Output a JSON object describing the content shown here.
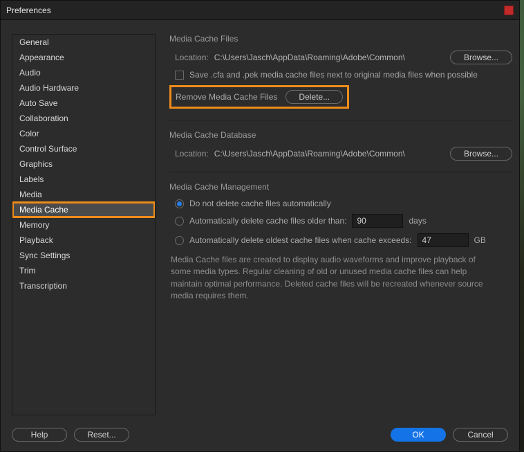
{
  "window": {
    "title": "Preferences"
  },
  "sidebar": {
    "items": [
      {
        "label": "General"
      },
      {
        "label": "Appearance"
      },
      {
        "label": "Audio"
      },
      {
        "label": "Audio Hardware"
      },
      {
        "label": "Auto Save"
      },
      {
        "label": "Collaboration"
      },
      {
        "label": "Color"
      },
      {
        "label": "Control Surface"
      },
      {
        "label": "Graphics"
      },
      {
        "label": "Labels"
      },
      {
        "label": "Media"
      },
      {
        "label": "Media Cache",
        "selected": true
      },
      {
        "label": "Memory"
      },
      {
        "label": "Playback"
      },
      {
        "label": "Sync Settings"
      },
      {
        "label": "Trim"
      },
      {
        "label": "Transcription"
      }
    ]
  },
  "cacheFiles": {
    "title": "Media Cache Files",
    "locationLabel": "Location:",
    "locationValue": "C:\\Users\\Jasch\\AppData\\Roaming\\Adobe\\Common\\",
    "browse": "Browse...",
    "saveNext": "Save .cfa and .pek media cache files next to original media files when possible",
    "removeLabel": "Remove Media Cache Files",
    "delete": "Delete..."
  },
  "cacheDb": {
    "title": "Media Cache Database",
    "locationLabel": "Location:",
    "locationValue": "C:\\Users\\Jasch\\AppData\\Roaming\\Adobe\\Common\\",
    "browse": "Browse..."
  },
  "mgmt": {
    "title": "Media Cache Management",
    "opt1": "Do not delete cache files automatically",
    "opt2a": "Automatically delete cache files older than:",
    "opt2val": "90",
    "opt2unit": "days",
    "opt3a": "Automatically delete oldest cache files when cache exceeds:",
    "opt3val": "47",
    "opt3unit": "GB",
    "desc": "Media Cache files are created to display audio waveforms and improve playback of some media types.  Regular cleaning of old or unused media cache files can help maintain optimal performance. Deleted cache files will be recreated whenever source media requires them."
  },
  "footer": {
    "help": "Help",
    "reset": "Reset...",
    "ok": "OK",
    "cancel": "Cancel"
  }
}
